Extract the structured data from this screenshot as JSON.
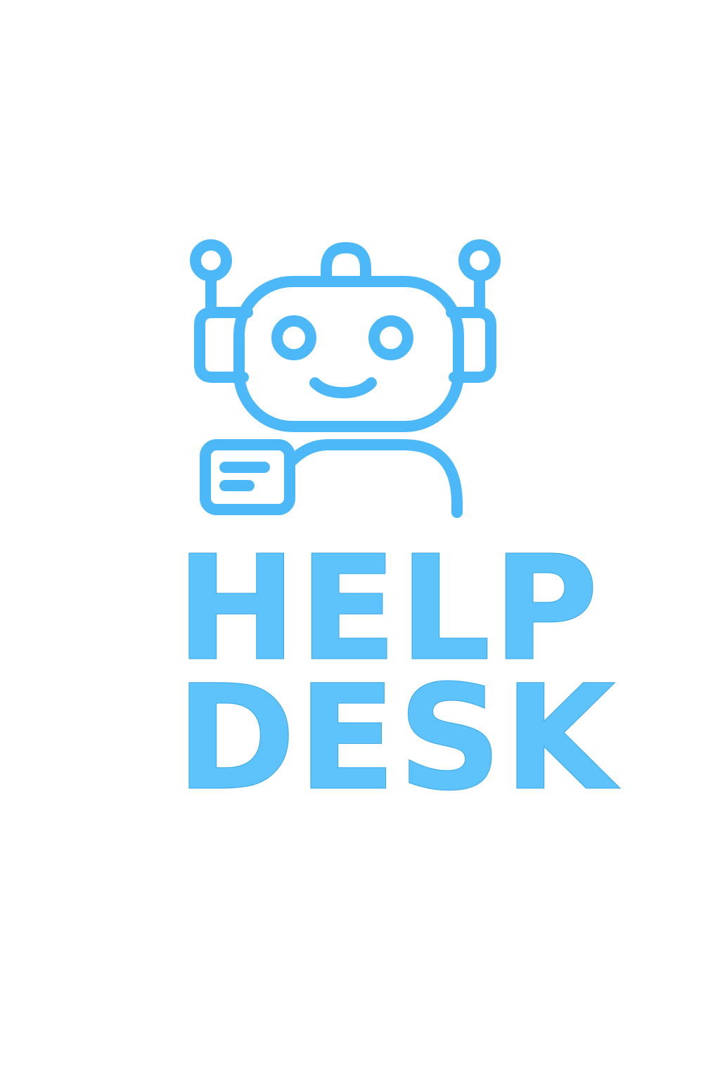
{
  "logo": {
    "accent_color": "#4db8f8",
    "text_color": "#5ec3fb",
    "icon": "robot-chat-icon"
  },
  "wordmark": {
    "line_1": "HELP",
    "line_2": "DESK"
  }
}
